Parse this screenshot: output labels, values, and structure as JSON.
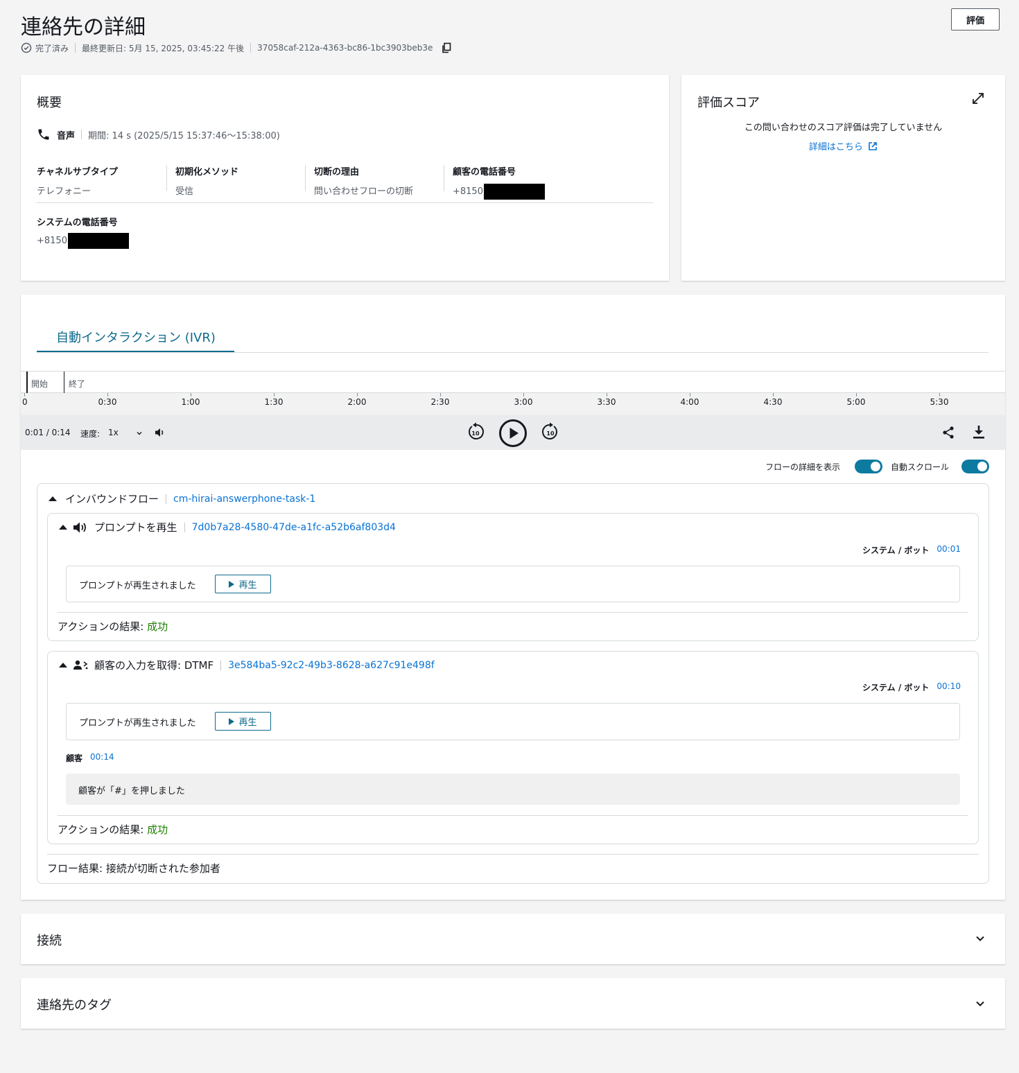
{
  "header": {
    "title": "連絡先の詳細",
    "status": "完了済み",
    "last_updated": "最終更新日: 5月 15, 2025, 03:45:22 午後",
    "contact_id": "37058caf-212a-4363-bc86-1bc3903beb3e",
    "evaluate_button": "評価"
  },
  "overview": {
    "title": "概要",
    "channel": "音声",
    "duration": "期間: 14 s (2025/5/15 15:37:46〜15:38:00)",
    "fields": [
      {
        "label": "チャネルサブタイプ",
        "value": "テレフォニー"
      },
      {
        "label": "初期化メソッド",
        "value": "受信"
      },
      {
        "label": "切断の理由",
        "value": "問い合わせフローの切断"
      },
      {
        "label": "顧客の電話番号",
        "value": "+8150"
      }
    ],
    "system_phone_label": "システムの電話番号",
    "system_phone_value": "+8150"
  },
  "score": {
    "title": "評価スコア",
    "message": "この問い合わせのスコア評価は完了していません",
    "link": "詳細はこちら"
  },
  "ivr": {
    "tab": "自動インタラクション (IVR)",
    "timeline": {
      "start_label": "開始",
      "end_label": "終了",
      "ticks": [
        "0",
        "0:30",
        "1:00",
        "1:30",
        "2:00",
        "2:30",
        "3:00",
        "3:30",
        "4:00",
        "4:30",
        "5:00",
        "5:30"
      ]
    },
    "player": {
      "time": "0:01 / 0:14",
      "speed_label": "速度:",
      "speed_value": "1x",
      "progress": 0.07
    },
    "toggles": {
      "flow_details": "フローの詳細を表示",
      "auto_scroll": "自動スクロール"
    },
    "flow": {
      "title": "インバウンドフロー",
      "name": "cm-hirai-answerphone-task-1",
      "blocks": [
        {
          "type": "プロンプトを再生",
          "id": "7d0b7a28-4580-47de-a1fc-a52b6af803d4",
          "speaker": "システム / ボット",
          "time": "00:01",
          "message": "プロンプトが再生されました",
          "play": "再生",
          "result_label": "アクションの結果:",
          "result_value": "成功"
        },
        {
          "type": "顧客の入力を取得: DTMF",
          "id": "3e584ba5-92c2-49b3-8628-a627c91e498f",
          "speaker": "システム / ボット",
          "time": "00:10",
          "message": "プロンプトが再生されました",
          "play": "再生",
          "customer_label": "顧客",
          "customer_time": "00:14",
          "customer_message": "顧客が「#」を押しました",
          "result_label": "アクションの結果:",
          "result_value": "成功"
        }
      ],
      "flow_result": "フロー結果: 接続が切断された参加者"
    }
  },
  "sections": {
    "connection": "接続",
    "tags": "連絡先のタグ"
  }
}
